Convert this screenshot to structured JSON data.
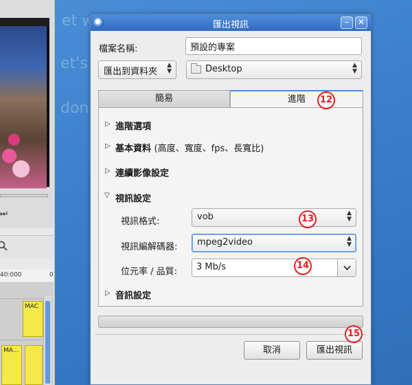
{
  "background_texts": [
    "et with Co",
    "et's",
    "done"
  ],
  "app": {
    "timeline_times": [
      "40:000",
      "0"
    ],
    "clips": [
      "MAC",
      "MA..."
    ],
    "transport_symbol": "⏭"
  },
  "dialog": {
    "title": "匯出視訊",
    "minimize_symbol": "–",
    "close_symbol": "✕",
    "filename_label": "檔案名稱:",
    "filename_value": "預設的專案",
    "destination_mode": "匯出到資料夾",
    "folder_value": "Desktop",
    "tabs": [
      {
        "label": "簡易",
        "active": false
      },
      {
        "label": "進階",
        "active": true
      }
    ],
    "sections": {
      "advanced_options": "進階選項",
      "basic_info": "基本資料",
      "basic_info_detail": "(高度、寬度、fps、長寬比)",
      "continuous_image": "連續影像設定",
      "video_settings": "視訊設定",
      "audio_settings": "音訊設定"
    },
    "video": {
      "format_label": "視訊格式:",
      "format_value": "vob",
      "codec_label": "視訊編解碼器:",
      "codec_value": "mpeg2video",
      "bitrate_label": "位元率 / 品質:",
      "bitrate_value": "3 Mb/s"
    },
    "buttons": {
      "cancel": "取消",
      "export": "匯出視訊"
    },
    "expander_collapsed": "▷",
    "expander_expanded": "▽"
  },
  "markers": [
    "12",
    "13",
    "14",
    "15"
  ],
  "colors": {
    "titlebar": "#2f6cc2",
    "marker": "#e02020",
    "focus": "#4a8ad8"
  }
}
